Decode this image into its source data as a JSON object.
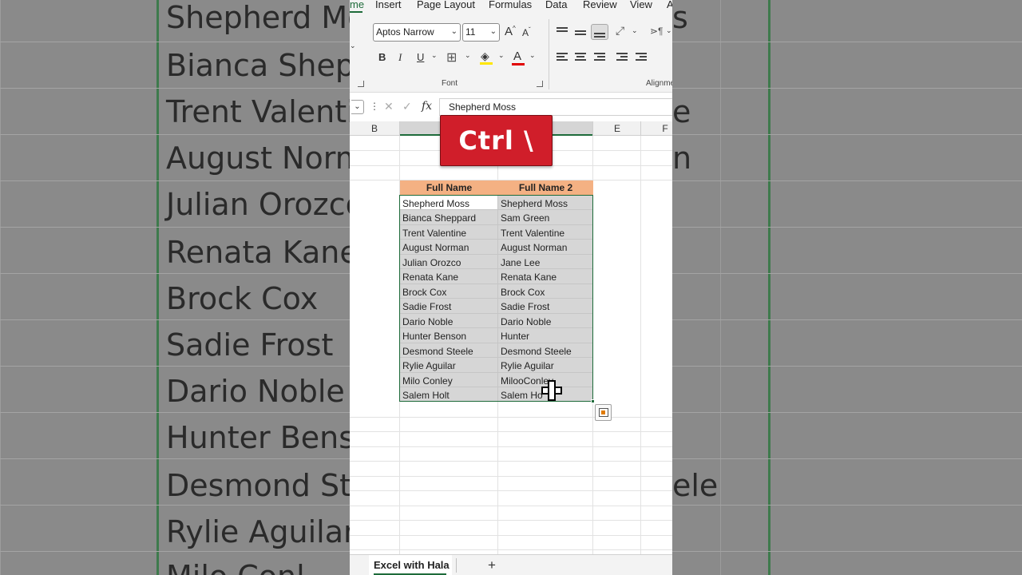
{
  "menu": {
    "items": [
      "me",
      "Insert",
      "Page Layout",
      "Formulas",
      "Data",
      "Review",
      "View",
      "A"
    ]
  },
  "ribbon": {
    "font_name": "Aptos Narrow",
    "font_size": "11",
    "font_group_label": "Font",
    "alignment_group_label": "Alignme",
    "bold": "B",
    "italic": "I",
    "underline": "U",
    "grow_font": "A",
    "shrink_font": "A",
    "font_color_letter": "A"
  },
  "formula_bar": {
    "fx": "fx",
    "value": "Shepherd Moss"
  },
  "columns": {
    "b": "B",
    "e": "E",
    "f": "F"
  },
  "table": {
    "headers": [
      "Full Name",
      "Full Name 2"
    ],
    "col1": [
      "Shepherd Moss",
      "Bianca Sheppard",
      "Trent Valentine",
      "August Norman",
      "Julian Orozco",
      "Renata Kane",
      "Brock Cox",
      "Sadie Frost",
      "Dario Noble",
      "Hunter Benson",
      "Desmond Steele",
      "Rylie Aguilar",
      "Milo Conley",
      "Salem Holt"
    ],
    "col2": [
      "Shepherd Moss",
      "Sam Green",
      "Trent Valentine",
      "August Norman",
      "Jane Lee",
      "Renata Kane",
      "Brock Cox",
      "Sadie Frost",
      "Dario Noble",
      "Hunter",
      "Desmond Steele",
      "Rylie Aguilar",
      "MilooConley",
      "Salem Ho"
    ]
  },
  "overlay": {
    "shortcut": "Ctrl \\"
  },
  "sheets": {
    "active": "Excel with Hala",
    "add": "+"
  },
  "background": {
    "left_names": [
      "Shepherd Mos",
      "Bianca Shepp",
      "Trent Valentir",
      "August Norma",
      "Julian Orozco",
      "Renata Kane",
      "Brock Cox",
      "Sadie Frost",
      "Dario Noble",
      "Hunter Benso",
      "Desmond Ste",
      "Rylie Aguilar",
      "Milo Conl"
    ],
    "right_fragments": [
      "s",
      "e",
      "n",
      "ele"
    ]
  },
  "colors": {
    "accent": "#1e6b3a",
    "header_fill": "#f4b183",
    "badge": "#d01e2a",
    "selection": "#d6d6d6"
  }
}
